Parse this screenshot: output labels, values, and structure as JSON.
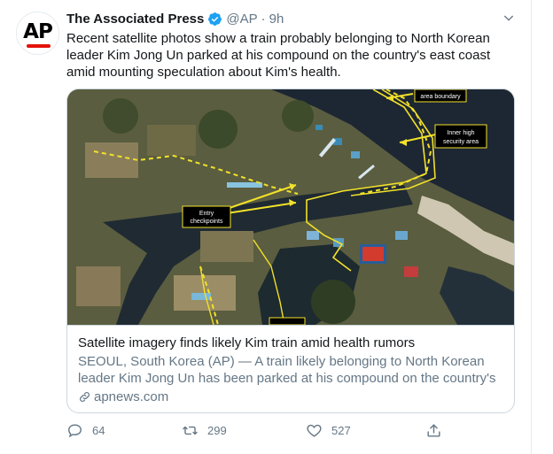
{
  "tweet": {
    "display_name": "The Associated Press",
    "handle": "@AP",
    "separator": "·",
    "time": "9h",
    "avatar_text": "AP",
    "text": "Recent satellite photos show a train probably belonging to North Korean leader Kim Jong Un parked at his compound on the country's east coast amid mounting speculation about Kim's health.",
    "card": {
      "title": "Satellite imagery finds likely Kim train amid health rumors",
      "description": "SEOUL, South Korea (AP) — A train likely belonging to North Korean leader Kim Jong Un has been parked at his compound on the country's ...",
      "domain": "apnews.com",
      "image_labels": {
        "area_boundary": "area boundary",
        "inner_line1": "Inner high",
        "inner_line2": "security area",
        "entry_line1": "Entry",
        "entry_line2": "checkpoints"
      }
    },
    "actions": {
      "replies": "64",
      "retweets": "299",
      "likes": "527"
    }
  },
  "colors": {
    "verified": "#1da1f2",
    "brand_red": "#e3120b",
    "secondary_text": "#657786",
    "annotation_yellow": "#f2e12a"
  }
}
